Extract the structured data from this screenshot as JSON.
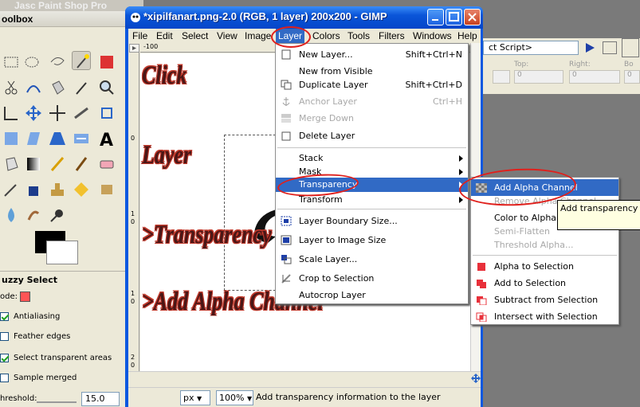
{
  "background_app": {
    "title": "Jasc Paint Shop Pro",
    "toolbox_title": "oolbox",
    "tool_options_title": "uzzy Select",
    "mode_label": "ode:",
    "antialiasing": "Antialiasing",
    "feather_edges": "Feather edges",
    "select_transparent": "Select transparent areas",
    "sample_merged": "Sample merged",
    "threshold_label": "hreshold:",
    "threshold_value": "15.0",
    "script_field": "ct Script>",
    "labels": {
      "top": "Top:",
      "right": "Right:",
      "bottom": "Bo"
    },
    "field_value": "0"
  },
  "gimp": {
    "window_title": "*xipilfanart.png-2.0 (RGB, 1 layer) 200x200 - GIMP",
    "menus": [
      "File",
      "Edit",
      "Select",
      "View",
      "Image",
      "Layer",
      "Colors",
      "Tools",
      "Filters",
      "Windows",
      "Help"
    ],
    "active_menu": "Layer",
    "ruler_top": "-100",
    "ruler_left": [
      "0",
      "1",
      "0",
      "1",
      "0",
      "2",
      "0"
    ],
    "status": {
      "unit": "px",
      "zoom": "100%",
      "message": "Add transparency information to the layer"
    }
  },
  "layer_menu": {
    "items": [
      {
        "label": "New Layer...",
        "shortcut": "Shift+Ctrl+N",
        "disabled": false,
        "icon": "new-layer-icon"
      },
      {
        "label": "New from Visible",
        "shortcut": "",
        "disabled": false,
        "icon": ""
      },
      {
        "label": "Duplicate Layer",
        "shortcut": "Shift+Ctrl+D",
        "disabled": false,
        "icon": "duplicate-icon"
      },
      {
        "label": "Anchor Layer",
        "shortcut": "Ctrl+H",
        "disabled": true,
        "icon": "anchor-icon"
      },
      {
        "label": "Merge Down",
        "shortcut": "",
        "disabled": true,
        "icon": "merge-icon"
      },
      {
        "label": "Delete Layer",
        "shortcut": "",
        "disabled": false,
        "icon": "delete-icon"
      },
      {
        "label": "Stack",
        "shortcut": "",
        "disabled": false,
        "icon": "",
        "submenu": true
      },
      {
        "label": "Mask",
        "shortcut": "",
        "disabled": false,
        "icon": "",
        "submenu": true
      },
      {
        "label": "Transparency",
        "shortcut": "",
        "disabled": false,
        "icon": "",
        "submenu": true
      },
      {
        "label": "Transform",
        "shortcut": "",
        "disabled": false,
        "icon": "",
        "submenu": true
      },
      {
        "label": "Layer Boundary Size...",
        "shortcut": "",
        "disabled": false,
        "icon": "boundary-icon"
      },
      {
        "label": "Layer to Image Size",
        "shortcut": "",
        "disabled": false,
        "icon": "fit-icon"
      },
      {
        "label": "Scale Layer...",
        "shortcut": "",
        "disabled": false,
        "icon": "scale-icon"
      },
      {
        "label": "Crop to Selection",
        "shortcut": "",
        "disabled": false,
        "icon": "crop-icon"
      },
      {
        "label": "Autocrop Layer",
        "shortcut": "",
        "disabled": false,
        "icon": ""
      }
    ]
  },
  "transparency_menu": {
    "items": [
      {
        "label": "Add Alpha Channel",
        "disabled": false
      },
      {
        "label": "Remove Alpha Channel",
        "disabled": true
      },
      {
        "label": "Color to Alpha...",
        "disabled": false
      },
      {
        "label": "Semi-Flatten",
        "disabled": true
      },
      {
        "label": "Threshold Alpha...",
        "disabled": true
      },
      {
        "label": "Alpha to Selection",
        "disabled": false
      },
      {
        "label": "Add to Selection",
        "disabled": false
      },
      {
        "label": "Subtract from Selection",
        "disabled": false
      },
      {
        "label": "Intersect with Selection",
        "disabled": false
      }
    ]
  },
  "tooltip": "Add transparency info",
  "annotations": [
    "Click",
    "Layer",
    ">Transparency",
    ">Add Alpha Channel"
  ],
  "colors": {
    "highlight": "#316ac5",
    "xp_blue": "#0a58e0",
    "annotation_red": "#e0201c"
  }
}
